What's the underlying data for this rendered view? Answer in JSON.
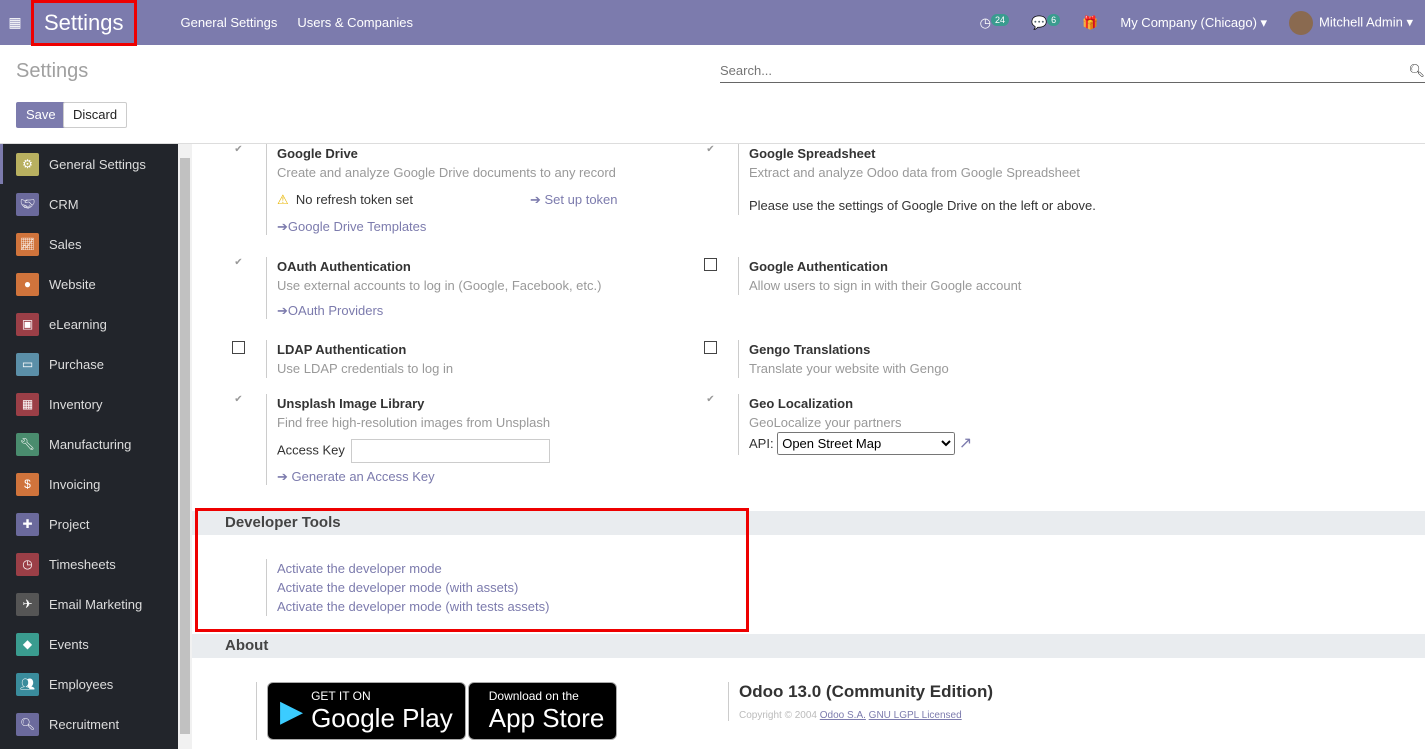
{
  "navbar": {
    "brand": "Settings",
    "menu": [
      "General Settings",
      "Users & Companies"
    ],
    "activity_count": "24",
    "messages_count": "6",
    "company": "My Company (Chicago)",
    "user": "Mitchell Admin"
  },
  "control_panel": {
    "title": "Settings",
    "search_placeholder": "Search...",
    "save": "Save",
    "discard": "Discard"
  },
  "sidebar": {
    "items": [
      {
        "label": "General Settings",
        "color": "#b8b060",
        "icon": "gear-icon"
      },
      {
        "label": "CRM",
        "color": "#6b6a9c",
        "icon": "handshake-icon"
      },
      {
        "label": "Sales",
        "color": "#d0743c",
        "icon": "chart-icon"
      },
      {
        "label": "Website",
        "color": "#d0743c",
        "icon": "globe-icon"
      },
      {
        "label": "eLearning",
        "color": "#9b3f47",
        "icon": "presentation-icon"
      },
      {
        "label": "Purchase",
        "color": "#5b8fa8",
        "icon": "credit-card-icon"
      },
      {
        "label": "Inventory",
        "color": "#9b3f47",
        "icon": "box-icon"
      },
      {
        "label": "Manufacturing",
        "color": "#4a8c6e",
        "icon": "wrench-icon"
      },
      {
        "label": "Invoicing",
        "color": "#d0743c",
        "icon": "invoice-icon"
      },
      {
        "label": "Project",
        "color": "#6b6a9c",
        "icon": "puzzle-icon"
      },
      {
        "label": "Timesheets",
        "color": "#9b3f47",
        "icon": "stopwatch-icon"
      },
      {
        "label": "Email Marketing",
        "color": "#555",
        "icon": "paper-plane-icon"
      },
      {
        "label": "Events",
        "color": "#3a9c8f",
        "icon": "ticket-icon"
      },
      {
        "label": "Employees",
        "color": "#3a8c9c",
        "icon": "users-icon"
      },
      {
        "label": "Recruitment",
        "color": "#6b6a9c",
        "icon": "search-icon"
      }
    ]
  },
  "settings": {
    "google_drive": {
      "title": "Google Drive",
      "desc": "Create and analyze Google Drive documents to any record",
      "warning": "No refresh token set",
      "setup": "Set up token",
      "templates": "Google Drive Templates",
      "checked": true
    },
    "google_spreadsheet": {
      "title": "Google Spreadsheet",
      "desc": "Extract and analyze Odoo data from Google Spreadsheet",
      "note": "Please use the settings of Google Drive on the left or above.",
      "checked": true
    },
    "oauth": {
      "title": "OAuth Authentication",
      "desc": "Use external accounts to log in (Google, Facebook, etc.)",
      "link": "OAuth Providers",
      "checked": true
    },
    "google_auth": {
      "title": "Google Authentication",
      "desc": "Allow users to sign in with their Google account",
      "checked": false
    },
    "ldap": {
      "title": "LDAP Authentication",
      "desc": "Use LDAP credentials to log in",
      "checked": false
    },
    "gengo": {
      "title": "Gengo Translations",
      "desc": "Translate your website with Gengo",
      "checked": false
    },
    "unsplash": {
      "title": "Unsplash Image Library",
      "desc": "Find free high-resolution images from Unsplash",
      "access_key_label": "Access Key",
      "access_key_value": "",
      "generate": "Generate an Access Key",
      "checked": true
    },
    "geo": {
      "title": "Geo Localization",
      "desc": "GeoLocalize your partners",
      "api_label": "API:",
      "api_value": "Open Street Map",
      "checked": true
    }
  },
  "developer_tools": {
    "title": "Developer Tools",
    "links": [
      "Activate the developer mode",
      "Activate the developer mode (with assets)",
      "Activate the developer mode (with tests assets)"
    ]
  },
  "about": {
    "title": "About",
    "google_play_top": "GET IT ON",
    "google_play": "Google Play",
    "app_store_top": "Download on the",
    "app_store": "App Store",
    "version": "Odoo 13.0 (Community Edition)",
    "copyright": "Copyright © 2004",
    "company_link": "Odoo S.A.",
    "license_link": "GNU LGPL Licensed"
  }
}
